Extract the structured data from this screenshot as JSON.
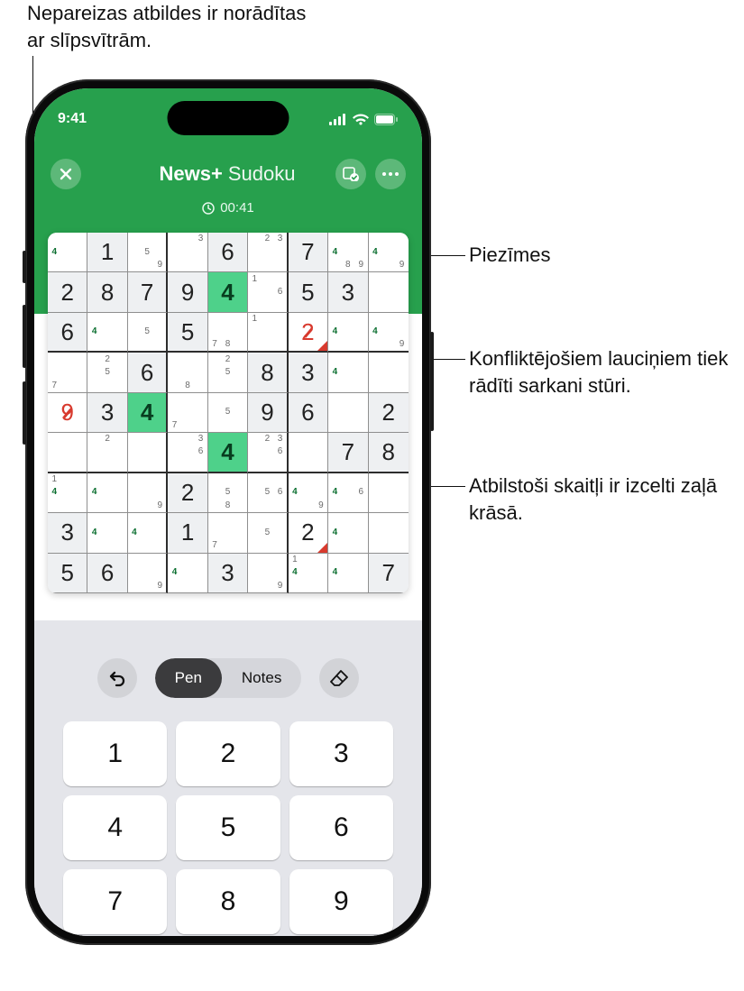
{
  "callouts": {
    "top_left": "Nepareizas atbildes ir norādītas ar slīpsvītrām.",
    "notes": "Piezīmes",
    "conflict": "Konfliktējošiem lauciņiem tiek rādīti sarkani stūri.",
    "highlight": "Atbilstoši skaitļi ir izcelti zaļā krāsā."
  },
  "status": {
    "time": "9:41"
  },
  "title": {
    "news": "News",
    "plus": "+",
    "sudoku": "Sudoku"
  },
  "timer": {
    "value": "00:41"
  },
  "tools": {
    "pen": "Pen",
    "notes": "Notes"
  },
  "keypad": [
    "1",
    "2",
    "3",
    "4",
    "5",
    "6",
    "7",
    "8",
    "9"
  ],
  "grid": [
    [
      {
        "notes": {
          "4": "h"
        }
      },
      {
        "given": true,
        "v": "1"
      },
      {
        "notes": {
          "5": "n",
          "9": "n"
        }
      },
      {
        "notes": {
          "3": "n"
        }
      },
      {
        "given": true,
        "v": "6"
      },
      {
        "notes": {
          "2": "n",
          "3": "n"
        }
      },
      {
        "given": true,
        "v": "7"
      },
      {
        "notes": {
          "4": "h",
          "8": "n",
          "9": "n"
        }
      },
      {
        "notes": {
          "4": "h",
          "9": "n"
        }
      }
    ],
    [
      {
        "given": true,
        "v": "2"
      },
      {
        "given": true,
        "v": "8"
      },
      {
        "given": true,
        "v": "7"
      },
      {
        "given": true,
        "v": "9"
      },
      {
        "v": "4",
        "hl": true
      },
      {
        "notes": {
          "1": "n",
          "6": "n"
        }
      },
      {
        "given": true,
        "v": "5"
      },
      {
        "given": true,
        "v": "3"
      },
      {}
    ],
    [
      {
        "given": true,
        "v": "6"
      },
      {
        "notes": {
          "4": "h"
        }
      },
      {
        "notes": {
          "5": "n"
        }
      },
      {
        "given": true,
        "v": "5"
      },
      {
        "notes": {
          "7": "n",
          "8": "n"
        }
      },
      {
        "notes": {
          "1": "n"
        }
      },
      {
        "v": "2",
        "wrong": true,
        "conflict": true
      },
      {
        "notes": {
          "4": "h"
        }
      },
      {
        "notes": {
          "4": "h",
          "9": "n"
        }
      }
    ],
    [
      {
        "notes": {
          "7": "n"
        }
      },
      {
        "notes": {
          "2": "n",
          "5": "n"
        }
      },
      {
        "given": true,
        "v": "6"
      },
      {
        "notes": {
          "8": "n"
        }
      },
      {
        "notes": {
          "2": "n",
          "5": "n"
        }
      },
      {
        "given": true,
        "v": "8"
      },
      {
        "given": true,
        "v": "3"
      },
      {
        "notes": {
          "4": "h"
        }
      },
      {}
    ],
    [
      {
        "v": "9",
        "wrong": true
      },
      {
        "given": true,
        "v": "3"
      },
      {
        "v": "4",
        "hl": true
      },
      {
        "notes": {
          "7": "n"
        }
      },
      {
        "notes": {
          "5": "n"
        }
      },
      {
        "given": true,
        "v": "9"
      },
      {
        "given": true,
        "v": "6"
      },
      {},
      {
        "given": true,
        "v": "2"
      }
    ],
    [
      {},
      {
        "notes": {
          "2": "n"
        }
      },
      {},
      {
        "notes": {
          "3": "n",
          "6": "n"
        }
      },
      {
        "v": "4",
        "hl": true
      },
      {
        "notes": {
          "2": "n",
          "3": "n",
          "6": "n"
        }
      },
      {},
      {
        "given": true,
        "v": "7"
      },
      {
        "given": true,
        "v": "8"
      }
    ],
    [
      {
        "notes": {
          "1": "n",
          "4": "h"
        }
      },
      {
        "notes": {
          "4": "h"
        }
      },
      {
        "notes": {
          "9": "n"
        }
      },
      {
        "given": true,
        "v": "2"
      },
      {
        "notes": {
          "5": "n",
          "8": "n"
        }
      },
      {
        "notes": {
          "5": "n",
          "6": "n"
        }
      },
      {
        "notes": {
          "4": "h",
          "9": "n"
        }
      },
      {
        "notes": {
          "4": "h",
          "6": "n"
        }
      },
      {}
    ],
    [
      {
        "given": true,
        "v": "3"
      },
      {
        "notes": {
          "4": "h"
        }
      },
      {
        "notes": {
          "4": "h"
        }
      },
      {
        "given": true,
        "v": "1"
      },
      {
        "notes": {
          "7": "n"
        }
      },
      {
        "notes": {
          "5": "n"
        }
      },
      {
        "v": "2",
        "conflict": true
      },
      {
        "notes": {
          "4": "h"
        }
      },
      {}
    ],
    [
      {
        "given": true,
        "v": "5"
      },
      {
        "given": true,
        "v": "6"
      },
      {
        "notes": {
          "9": "n"
        }
      },
      {
        "notes": {
          "4": "h"
        }
      },
      {
        "given": true,
        "v": "3"
      },
      {
        "notes": {
          "9": "n"
        }
      },
      {
        "notes": {
          "1": "n",
          "4": "h"
        }
      },
      {
        "notes": {
          "4": "h"
        }
      },
      {
        "given": true,
        "v": "7"
      }
    ]
  ]
}
